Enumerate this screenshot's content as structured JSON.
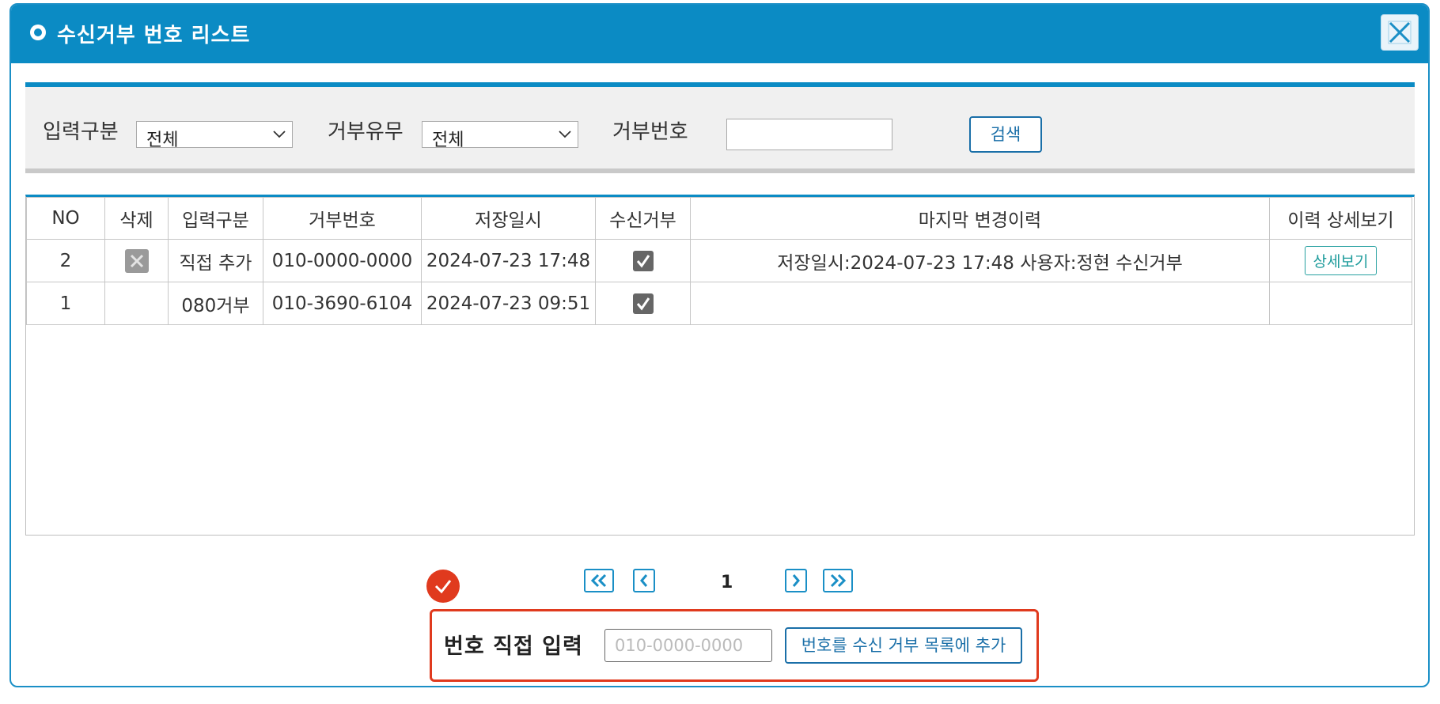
{
  "dialog": {
    "title": "수신거부 번호 리스트"
  },
  "filters": {
    "input_type_label": "입력구분",
    "input_type_value": "전체",
    "reject_status_label": "거부유무",
    "reject_status_value": "전체",
    "reject_number_label": "거부번호",
    "reject_number_value": "",
    "search_label": "검색"
  },
  "table": {
    "headers": [
      "NO",
      "삭제",
      "입력구분",
      "거부번호",
      "저장일시",
      "수신거부",
      "마지막 변경이력",
      "이력 상세보기"
    ],
    "rows": [
      {
        "no": "2",
        "deletable": true,
        "input_type": "직접 추가",
        "number": "010-0000-0000",
        "saved_at": "2024-07-23 17:48",
        "rejected": true,
        "last_change": "저장일시:2024-07-23 17:48 사용자:정현 수신거부",
        "detail_label": "상세보기"
      },
      {
        "no": "1",
        "deletable": false,
        "input_type": "080거부",
        "number": "010-3690-6104",
        "saved_at": "2024-07-23 09:51",
        "rejected": true,
        "last_change": "",
        "detail_label": ""
      }
    ]
  },
  "pagination": {
    "current_page": "1"
  },
  "manual_entry": {
    "label": "번호 직접 입력",
    "placeholder": "010-0000-0000",
    "add_button_label": "번호를 수신 거부 목록에 추가"
  },
  "colors": {
    "header_blue": "#0b8bc4",
    "highlight_red": "#e03a1e",
    "button_blue": "#1a6fa8",
    "detail_teal": "#1a9a9a"
  },
  "icons": [
    "title-bullet-icon",
    "close-icon",
    "chevron-down-icon",
    "delete-icon",
    "checkbox-checked-icon",
    "first-page-icon",
    "prev-page-icon",
    "next-page-icon",
    "last-page-icon",
    "check-mark-icon"
  ]
}
